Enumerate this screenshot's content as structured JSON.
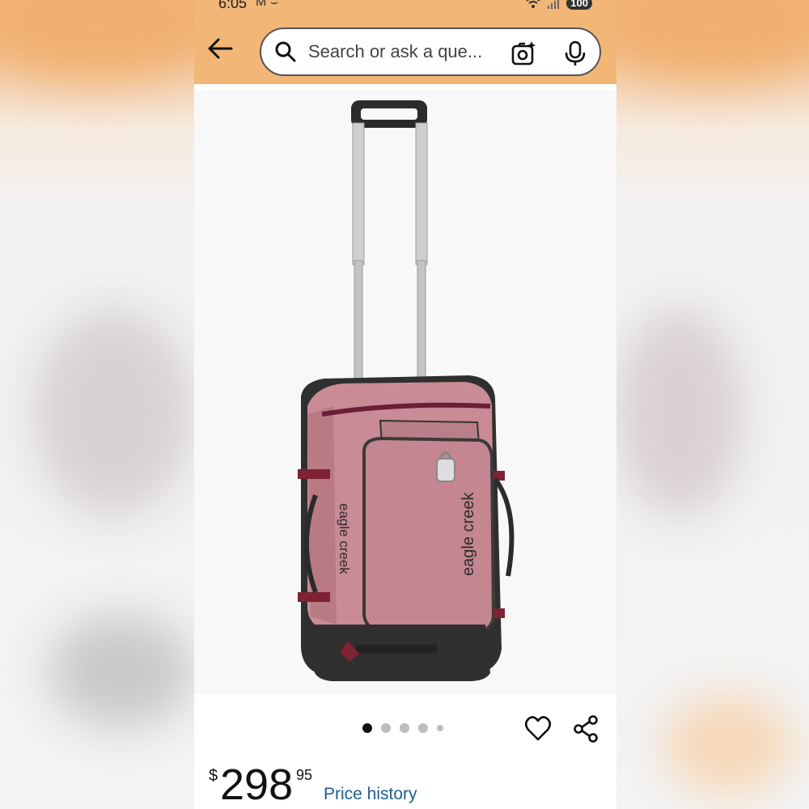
{
  "status_bar": {
    "time": "6:05",
    "notification_icons": "M ⌣",
    "battery": "100"
  },
  "search": {
    "placeholder": "Search or ask a que..."
  },
  "product": {
    "brand_text": "eagle creek",
    "image_count": 5,
    "active_image": 1
  },
  "price": {
    "currency": "$",
    "dollars": "298",
    "cents": "95",
    "history_label": "Price history"
  },
  "colors": {
    "header_bg": "#f2b677",
    "bag_pink": "#c98b95",
    "link_blue": "#1f5e8e"
  }
}
